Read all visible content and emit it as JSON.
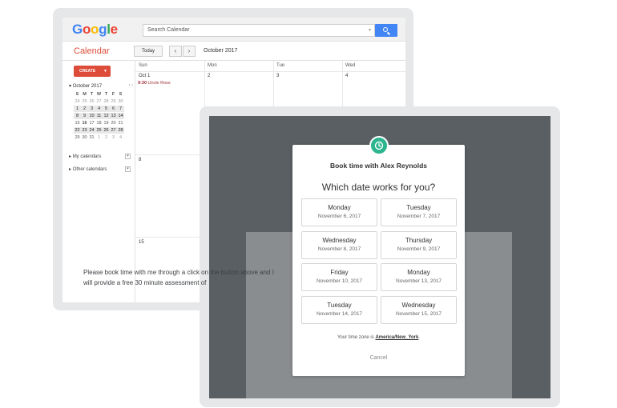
{
  "google": {
    "logo_letters": [
      "G",
      "o",
      "o",
      "g",
      "l",
      "e"
    ],
    "logo_colors": [
      "#4285f4",
      "#ea4335",
      "#fbbc05",
      "#4285f4",
      "#34a853",
      "#ea4335"
    ],
    "search_placeholder": "Search Calendar"
  },
  "calendar": {
    "app_title": "Calendar",
    "today_label": "Today",
    "prev_icon": "chevron-left-icon",
    "next_icon": "chevron-right-icon",
    "month_label": "October 2017",
    "create_label": "CREATE",
    "mini_month_label": "October 2017",
    "mini_weekdays": [
      "S",
      "M",
      "T",
      "W",
      "T",
      "F",
      "S"
    ],
    "mini_weeks": [
      [
        "24",
        "25",
        "26",
        "27",
        "28",
        "29",
        "30"
      ],
      [
        "1",
        "2",
        "3",
        "4",
        "5",
        "6",
        "7"
      ],
      [
        "8",
        "9",
        "10",
        "11",
        "12",
        "13",
        "14"
      ],
      [
        "15",
        "16",
        "17",
        "18",
        "19",
        "20",
        "21"
      ],
      [
        "22",
        "23",
        "24",
        "25",
        "26",
        "27",
        "28"
      ],
      [
        "29",
        "30",
        "31",
        "1",
        "2",
        "3",
        "4"
      ]
    ],
    "my_calendars": "My calendars",
    "other_calendars": "Other calendars",
    "day_headers": [
      "Sun",
      "Mon",
      "Tue",
      "Wed"
    ],
    "week1_dates": [
      "Oct 1",
      "2",
      "3",
      "4"
    ],
    "week2_first": "8",
    "week3_first": "15",
    "event_time": "9:30",
    "event_title": "Uncle Ross",
    "accent_color": "#dd4b39"
  },
  "booking": {
    "title": "Book time with Alex Reynolds",
    "question": "Which date works for you?",
    "dates": [
      {
        "day": "Monday",
        "date": "November 6, 2017"
      },
      {
        "day": "Tuesday",
        "date": "November 7, 2017"
      },
      {
        "day": "Wednesday",
        "date": "November 8, 2017"
      },
      {
        "day": "Thursday",
        "date": "November 9, 2017"
      },
      {
        "day": "Friday",
        "date": "November 10, 2017"
      },
      {
        "day": "Monday",
        "date": "November 13, 2017"
      },
      {
        "day": "Tuesday",
        "date": "November 14, 2017"
      },
      {
        "day": "Wednesday",
        "date": "November 15, 2017"
      }
    ],
    "timezone_prefix": "Your time zone is ",
    "timezone": "America/New_York",
    "timezone_suffix": ".",
    "cancel_label": "Cancel",
    "background_text": "Please book time with me through a click on the button above and I will provide a free 30 minute assessment of",
    "badge_color": "#2cb58e",
    "badge_icon": "clock-icon"
  }
}
